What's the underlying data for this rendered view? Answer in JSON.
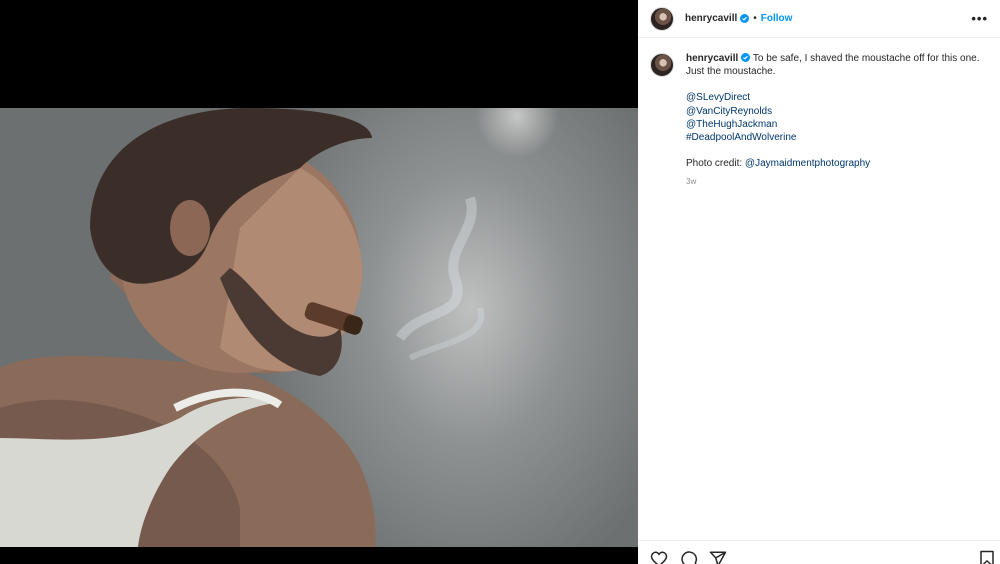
{
  "post": {
    "username": "henrycavill",
    "follow_label": "Follow",
    "separator": "•",
    "more_label": "•••",
    "caption": {
      "line1": "To be safe, I shaved the moustache off for this one.",
      "line2": "Just the moustache.",
      "mentions": [
        "@SLevyDirect",
        "@VanCityReynolds",
        "@TheHughJackman",
        "#DeadpoolAndWolverine"
      ],
      "credit_prefix": "Photo credit: ",
      "credit_handle": "@Jaymaidmentphotography"
    },
    "time_ago": "3w"
  },
  "icons": {
    "verified": "verified-badge-icon",
    "like": "heart-icon",
    "comment": "comment-icon",
    "share": "share-icon",
    "save": "bookmark-icon",
    "more": "more-options-icon"
  },
  "colors": {
    "follow": "#0095f6",
    "link": "#00376b",
    "verified": "#0095f6",
    "text": "#262626",
    "muted": "#8e8e8e"
  }
}
